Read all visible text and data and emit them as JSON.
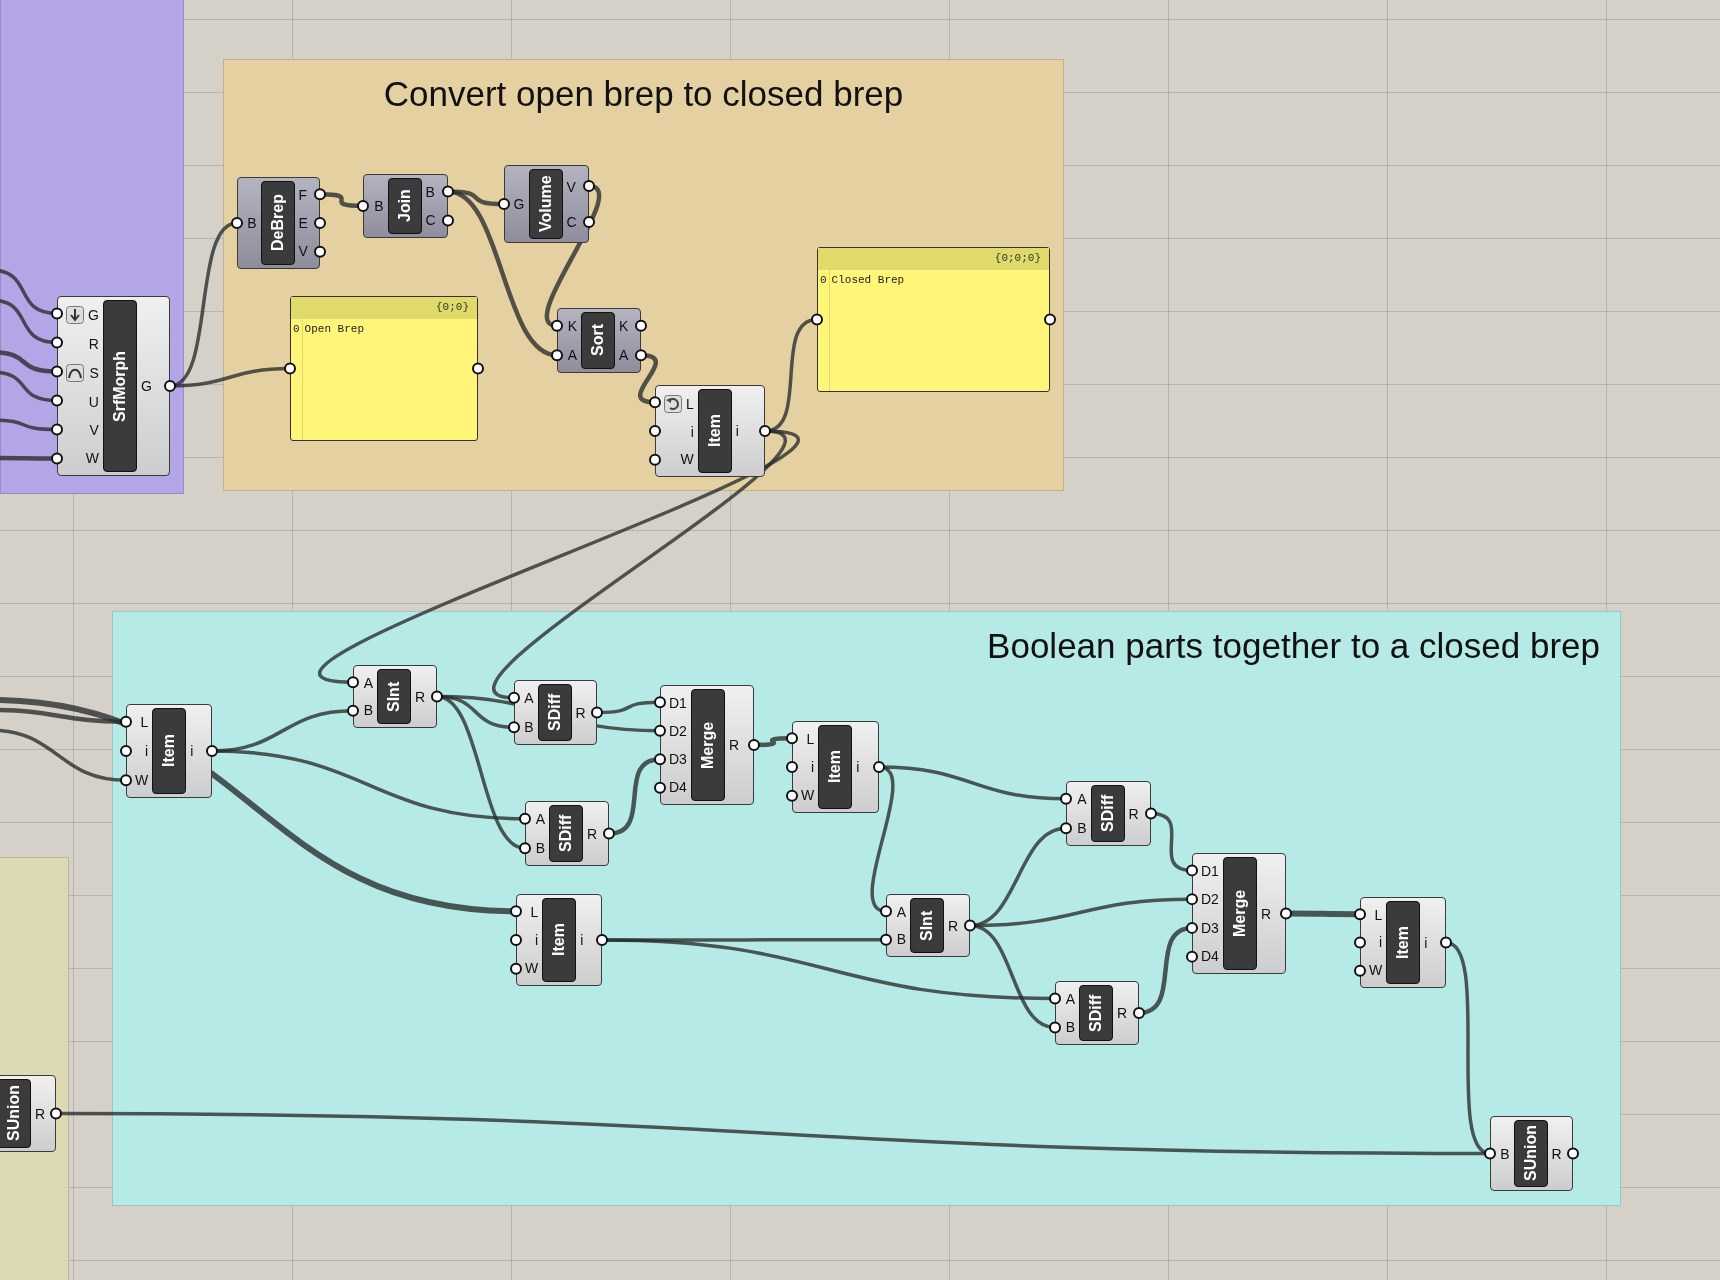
{
  "groups": [
    {
      "color": "#b4a5e6"
    },
    {
      "title": "Convert open brep to closed brep",
      "color": "#e5d0a2"
    },
    {
      "title": "Boolean parts together to a closed brep",
      "color": "#b6eae7"
    },
    {
      "color": "#dcd9b3"
    }
  ],
  "nodes": [
    {
      "kind": "component",
      "name": "SrfMorph",
      "preview": true,
      "inputs": [
        {
          "label": "G",
          "flatten": true
        },
        {
          "label": "R"
        },
        {
          "label": "S",
          "reparameterize": true
        },
        {
          "label": "U"
        },
        {
          "label": "V"
        },
        {
          "label": "W"
        }
      ],
      "outputs": [
        "G"
      ]
    },
    {
      "kind": "component",
      "name": "DeBrep",
      "preview": false,
      "inputs": [
        {
          "label": "B"
        }
      ],
      "outputs": [
        "F",
        "E",
        "V"
      ]
    },
    {
      "kind": "component",
      "name": "Join",
      "preview": false,
      "inputs": [
        {
          "label": "B"
        }
      ],
      "outputs": [
        "B",
        "C"
      ]
    },
    {
      "kind": "component",
      "name": "Volume",
      "preview": false,
      "inputs": [
        {
          "label": "G"
        }
      ],
      "outputs": [
        "V",
        "C"
      ]
    },
    {
      "kind": "panel",
      "path": "{0;0}",
      "items": [
        {
          "index": "0",
          "text": "Open Brep"
        }
      ]
    },
    {
      "kind": "component",
      "name": "Sort",
      "preview": false,
      "inputs": [
        {
          "label": "K"
        },
        {
          "label": "A"
        }
      ],
      "outputs": [
        "K",
        "A"
      ]
    },
    {
      "kind": "component",
      "name": "Item",
      "preview": true,
      "inputs": [
        {
          "label": "L",
          "reverse": true
        },
        {
          "label": "i"
        },
        {
          "label": "W"
        }
      ],
      "outputs": [
        "i"
      ]
    },
    {
      "kind": "panel",
      "path": "{0;0;0}",
      "items": [
        {
          "index": "0",
          "text": "Closed Brep"
        }
      ]
    },
    {
      "kind": "component",
      "name": "Item",
      "preview": true,
      "inputs": [
        {
          "label": "L"
        },
        {
          "label": "i"
        },
        {
          "label": "W"
        }
      ],
      "outputs": [
        "i"
      ]
    },
    {
      "kind": "component",
      "name": "SInt",
      "preview": true,
      "inputs": [
        {
          "label": "A"
        },
        {
          "label": "B"
        }
      ],
      "outputs": [
        "R"
      ]
    },
    {
      "kind": "component",
      "name": "SDiff",
      "preview": true,
      "inputs": [
        {
          "label": "A"
        },
        {
          "label": "B"
        }
      ],
      "outputs": [
        "R"
      ]
    },
    {
      "kind": "component",
      "name": "SDiff",
      "preview": true,
      "inputs": [
        {
          "label": "A"
        },
        {
          "label": "B"
        }
      ],
      "outputs": [
        "R"
      ]
    },
    {
      "kind": "component",
      "name": "Merge",
      "preview": true,
      "inputs": [
        {
          "label": "D1"
        },
        {
          "label": "D2"
        },
        {
          "label": "D3"
        },
        {
          "label": "D4"
        }
      ],
      "outputs": [
        "R"
      ]
    },
    {
      "kind": "component",
      "name": "Item",
      "preview": true,
      "inputs": [
        {
          "label": "L"
        },
        {
          "label": "i"
        },
        {
          "label": "W"
        }
      ],
      "outputs": [
        "i"
      ]
    },
    {
      "kind": "component",
      "name": "Item",
      "preview": true,
      "inputs": [
        {
          "label": "L"
        },
        {
          "label": "i"
        },
        {
          "label": "W"
        }
      ],
      "outputs": [
        "i"
      ]
    },
    {
      "kind": "component",
      "name": "SInt",
      "preview": true,
      "inputs": [
        {
          "label": "A"
        },
        {
          "label": "B"
        }
      ],
      "outputs": [
        "R"
      ]
    },
    {
      "kind": "component",
      "name": "SDiff",
      "preview": true,
      "inputs": [
        {
          "label": "A"
        },
        {
          "label": "B"
        }
      ],
      "outputs": [
        "R"
      ]
    },
    {
      "kind": "component",
      "name": "SDiff",
      "preview": true,
      "inputs": [
        {
          "label": "A"
        },
        {
          "label": "B"
        }
      ],
      "outputs": [
        "R"
      ]
    },
    {
      "kind": "component",
      "name": "Merge",
      "preview": true,
      "inputs": [
        {
          "label": "D1"
        },
        {
          "label": "D2"
        },
        {
          "label": "D3"
        },
        {
          "label": "D4"
        }
      ],
      "outputs": [
        "R"
      ]
    },
    {
      "kind": "component",
      "name": "Item",
      "preview": true,
      "inputs": [
        {
          "label": "L"
        },
        {
          "label": "i"
        },
        {
          "label": "W"
        }
      ],
      "outputs": [
        "i"
      ]
    },
    {
      "kind": "component",
      "name": "SUnion",
      "preview": true,
      "inputs": [
        {
          "label": "B"
        }
      ],
      "outputs": [
        "R"
      ]
    },
    {
      "kind": "component",
      "name": "SUnion",
      "preview": true,
      "outputs": [
        "R"
      ]
    }
  ]
}
